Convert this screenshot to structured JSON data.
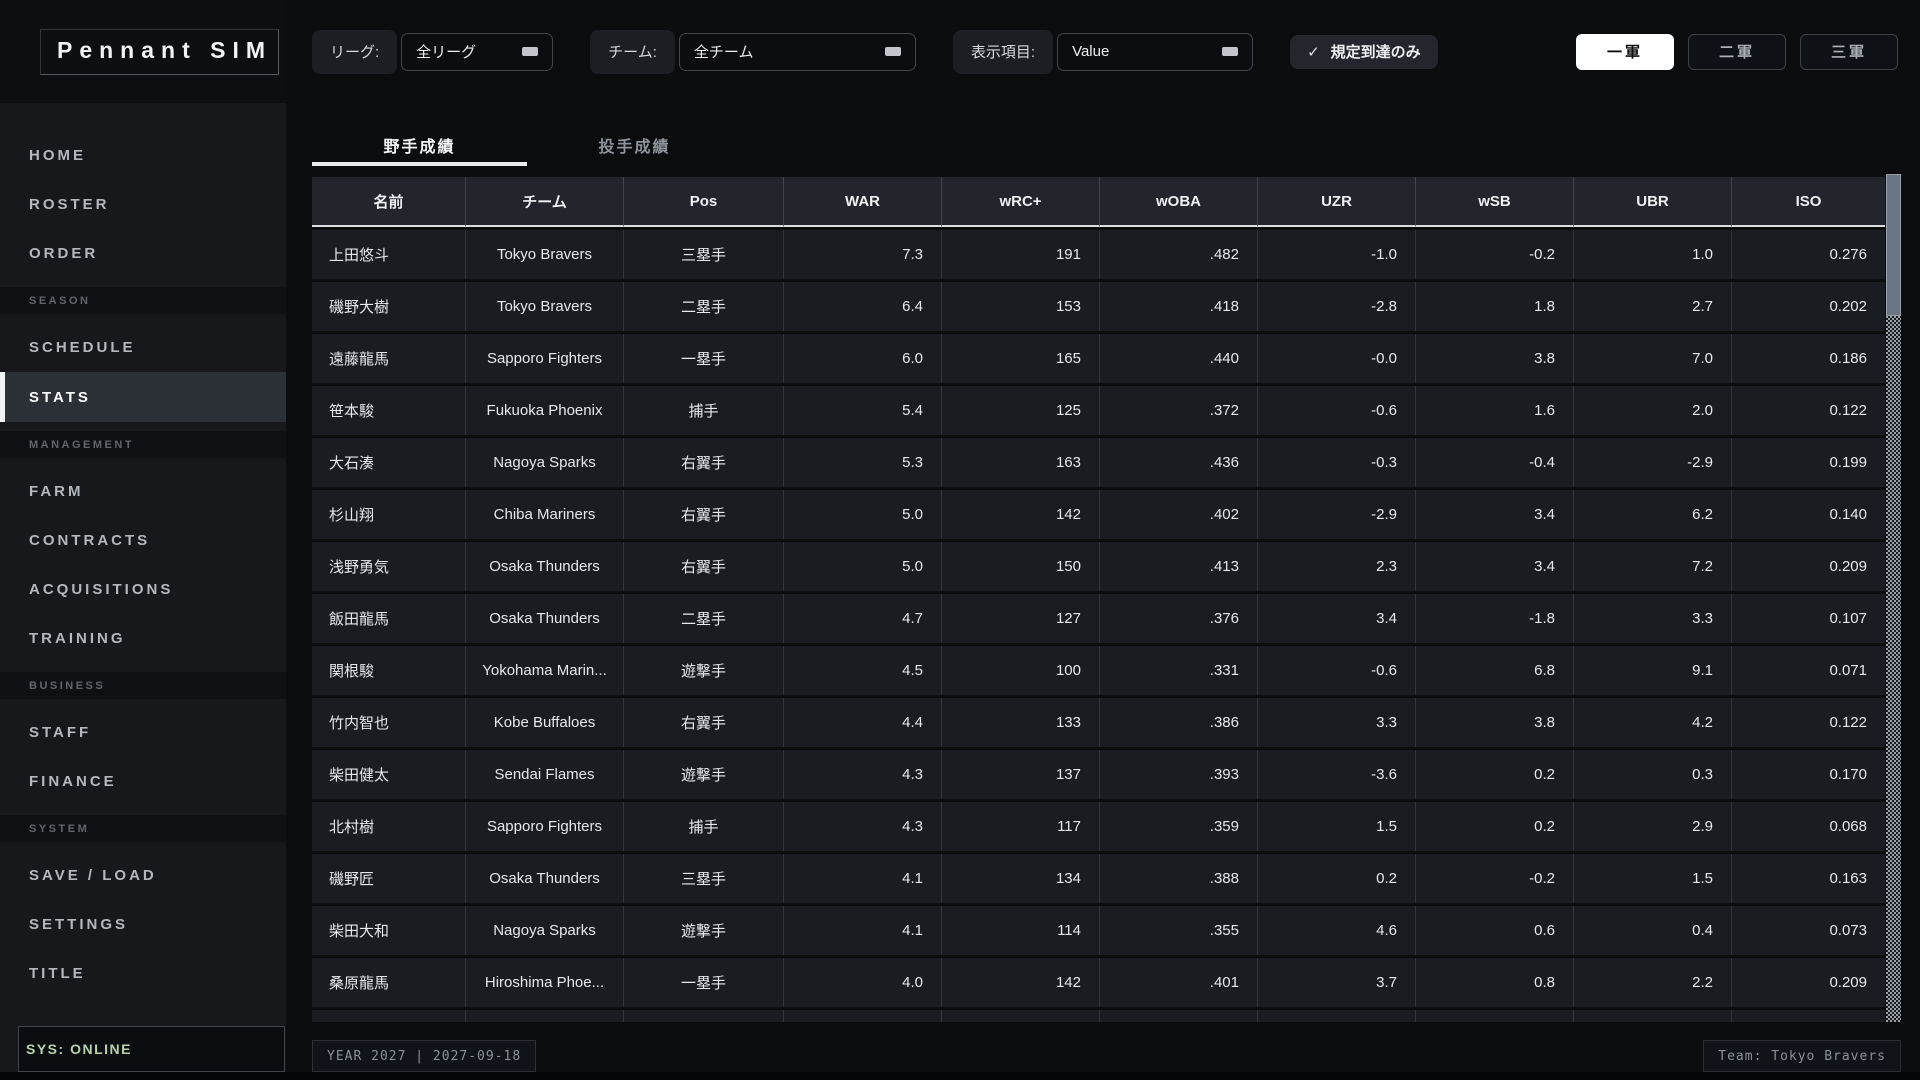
{
  "app": {
    "title": "Pennant SIM",
    "sys_status": "SYS: ONLINE"
  },
  "sidebar": {
    "items": [
      {
        "type": "item",
        "label": "HOME"
      },
      {
        "type": "item",
        "label": "ROSTER"
      },
      {
        "type": "item",
        "label": "ORDER"
      },
      {
        "type": "section",
        "label": "SEASON"
      },
      {
        "type": "item",
        "label": "SCHEDULE"
      },
      {
        "type": "item",
        "label": "STATS",
        "active": true
      },
      {
        "type": "section",
        "label": "MANAGEMENT"
      },
      {
        "type": "item",
        "label": "FARM"
      },
      {
        "type": "item",
        "label": "CONTRACTS"
      },
      {
        "type": "item",
        "label": "ACQUISITIONS"
      },
      {
        "type": "item",
        "label": "TRAINING"
      },
      {
        "type": "section",
        "label": "BUSINESS"
      },
      {
        "type": "item",
        "label": "STAFF"
      },
      {
        "type": "item",
        "label": "FINANCE"
      },
      {
        "type": "section",
        "label": "SYSTEM"
      },
      {
        "type": "item",
        "label": "SAVE / LOAD"
      },
      {
        "type": "item",
        "label": "SETTINGS"
      },
      {
        "type": "item",
        "label": "TITLE"
      }
    ]
  },
  "filters": {
    "league": {
      "label": "リーグ:",
      "value": "全リーグ"
    },
    "team": {
      "label": "チーム:",
      "value": "全チーム"
    },
    "display": {
      "label": "表示項目:",
      "value": "Value"
    }
  },
  "qualified": {
    "label": "規定到達のみ",
    "checked": true,
    "check_glyph": "✓"
  },
  "squads": [
    {
      "label": "一軍",
      "active": true
    },
    {
      "label": "二軍",
      "active": false
    },
    {
      "label": "三軍",
      "active": false
    }
  ],
  "tabs": [
    {
      "label": "野手成績",
      "active": true
    },
    {
      "label": "投手成績",
      "active": false
    }
  ],
  "table": {
    "columns": [
      "名前",
      "チーム",
      "Pos",
      "WAR",
      "wRC+",
      "wOBA",
      "UZR",
      "wSB",
      "UBR",
      "ISO"
    ],
    "rows": [
      [
        "上田悠斗",
        "Tokyo Bravers",
        "三塁手",
        "7.3",
        "191",
        ".482",
        "-1.0",
        "-0.2",
        "1.0",
        "0.276"
      ],
      [
        "磯野大樹",
        "Tokyo Bravers",
        "二塁手",
        "6.4",
        "153",
        ".418",
        "-2.8",
        "1.8",
        "2.7",
        "0.202"
      ],
      [
        "遠藤龍馬",
        "Sapporo Fighters",
        "一塁手",
        "6.0",
        "165",
        ".440",
        "-0.0",
        "3.8",
        "7.0",
        "0.186"
      ],
      [
        "笹本駿",
        "Fukuoka Phoenix",
        "捕手",
        "5.4",
        "125",
        ".372",
        "-0.6",
        "1.6",
        "2.0",
        "0.122"
      ],
      [
        "大石湊",
        "Nagoya Sparks",
        "右翼手",
        "5.3",
        "163",
        ".436",
        "-0.3",
        "-0.4",
        "-2.9",
        "0.199"
      ],
      [
        "杉山翔",
        "Chiba Mariners",
        "右翼手",
        "5.0",
        "142",
        ".402",
        "-2.9",
        "3.4",
        "6.2",
        "0.140"
      ],
      [
        "浅野勇気",
        "Osaka Thunders",
        "右翼手",
        "5.0",
        "150",
        ".413",
        "2.3",
        "3.4",
        "7.2",
        "0.209"
      ],
      [
        "飯田龍馬",
        "Osaka Thunders",
        "二塁手",
        "4.7",
        "127",
        ".376",
        "3.4",
        "-1.8",
        "3.3",
        "0.107"
      ],
      [
        "関根駿",
        "Yokohama Marin...",
        "遊撃手",
        "4.5",
        "100",
        ".331",
        "-0.6",
        "6.8",
        "9.1",
        "0.071"
      ],
      [
        "竹内智也",
        "Kobe Buffaloes",
        "右翼手",
        "4.4",
        "133",
        ".386",
        "3.3",
        "3.8",
        "4.2",
        "0.122"
      ],
      [
        "柴田健太",
        "Sendai Flames",
        "遊撃手",
        "4.3",
        "137",
        ".393",
        "-3.6",
        "0.2",
        "0.3",
        "0.170"
      ],
      [
        "北村樹",
        "Sapporo Fighters",
        "捕手",
        "4.3",
        "117",
        ".359",
        "1.5",
        "0.2",
        "2.9",
        "0.068"
      ],
      [
        "磯野匠",
        "Osaka Thunders",
        "三塁手",
        "4.1",
        "134",
        ".388",
        "0.2",
        "-0.2",
        "1.5",
        "0.163"
      ],
      [
        "柴田大和",
        "Nagoya Sparks",
        "遊撃手",
        "4.1",
        "114",
        ".355",
        "4.6",
        "0.6",
        "0.4",
        "0.073"
      ],
      [
        "桑原龍馬",
        "Hiroshima Phoe...",
        "一塁手",
        "4.0",
        "142",
        ".401",
        "3.7",
        "0.8",
        "2.2",
        "0.209"
      ]
    ]
  },
  "footer": {
    "left": "YEAR 2027 | 2027-09-18",
    "right": "Team: Tokyo Bravers"
  }
}
